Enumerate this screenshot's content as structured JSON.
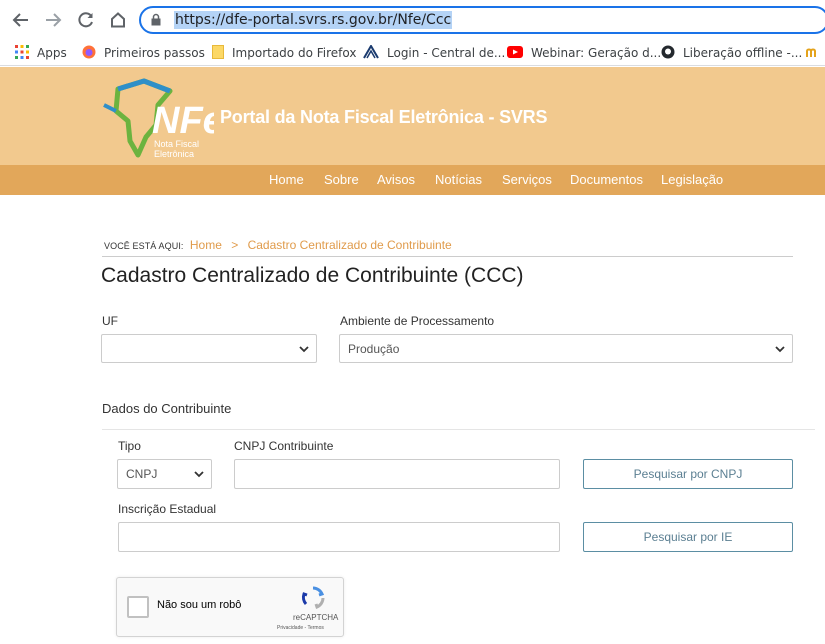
{
  "browser": {
    "url": "https://dfe-portal.svrs.rs.gov.br/Nfe/Ccc",
    "bookmarks": [
      {
        "label": "Apps",
        "icon": "apps-grid-icon"
      },
      {
        "label": "Primeiros passos",
        "icon": "firefox-icon"
      },
      {
        "label": "Importado do Firefox",
        "icon": "folder-icon"
      },
      {
        "label": "Login - Central de...",
        "icon": "site-icon"
      },
      {
        "label": "Webinar: Geração d...",
        "icon": "youtube-icon"
      },
      {
        "label": "Liberação offline -...",
        "icon": "github-icon"
      }
    ]
  },
  "site": {
    "logo_text": "NFe",
    "logo_sub1": "Nota Fiscal",
    "logo_sub2": "Eletrônica",
    "title": "Portal da Nota Fiscal Eletrônica - SVRS",
    "nav": [
      "Home",
      "Sobre",
      "Avisos",
      "Notícias",
      "Serviços",
      "Documentos",
      "Legislação"
    ]
  },
  "breadcrumb": {
    "label": "Você está aqui:",
    "home": "Home",
    "separator": ">",
    "current": "Cadastro Centralizado de Contribuinte"
  },
  "page": {
    "title": "Cadastro Centralizado de Contribuinte (CCC)"
  },
  "form": {
    "uf_label": "UF",
    "uf_value": "",
    "ambiente_label": "Ambiente de Processamento",
    "ambiente_value": "Produção",
    "section_title": "Dados do Contribuinte",
    "tipo_label": "Tipo",
    "tipo_value": "CNPJ",
    "cnpj_label": "CNPJ Contribuinte",
    "cnpj_value": "",
    "btn_cnpj": "Pesquisar por CNPJ",
    "ie_label": "Inscrição Estadual",
    "ie_value": "",
    "btn_ie": "Pesquisar por IE"
  },
  "captcha": {
    "text": "Não sou um robô",
    "brand": "reCAPTCHA",
    "terms": "Privacidade - Termos"
  },
  "colors": {
    "header_bg": "#f2c98e",
    "navbar_bg": "#e2a75a",
    "accent": "#e09b4b",
    "url_focus": "#1a73e8"
  }
}
